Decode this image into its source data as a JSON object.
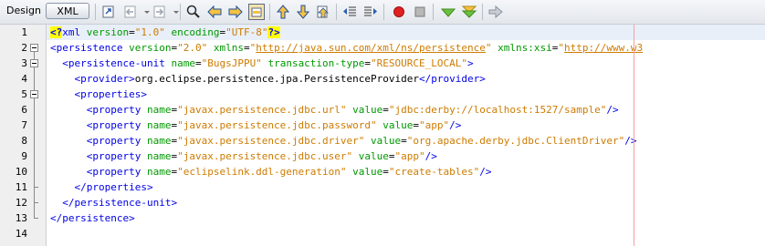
{
  "toolbar": {
    "design_tab": "Design",
    "xml_tab": "XML",
    "icons": [
      "go-to-source-icon",
      "back-icon",
      "forward-icon",
      "find-icon",
      "find-previous-icon",
      "find-next-icon",
      "toggle-highlight-icon",
      "previous-bookmark-icon",
      "next-bookmark-icon",
      "toggle-bookmark-icon",
      "shift-left-icon",
      "shift-right-icon",
      "start-macro-icon",
      "stop-macro-icon",
      "check-xml-icon",
      "validate-xml-icon",
      "xsl-transform-icon"
    ]
  },
  "editor": {
    "line_numbers": [
      "1",
      "2",
      "3",
      "4",
      "5",
      "6",
      "7",
      "8",
      "9",
      "10",
      "11",
      "12",
      "13",
      "14"
    ],
    "lines": [
      [
        {
          "t": "<?",
          "c": "pi"
        },
        {
          "t": "xml",
          "c": "tag"
        },
        {
          "t": " version",
          "c": "att"
        },
        {
          "t": "=",
          "c": "txt"
        },
        {
          "t": "\"1.0\"",
          "c": "val"
        },
        {
          "t": " encoding",
          "c": "att"
        },
        {
          "t": "=",
          "c": "txt"
        },
        {
          "t": "\"UTF-8\"",
          "c": "val"
        },
        {
          "t": "?>",
          "c": "pi"
        }
      ],
      [
        {
          "t": "<persistence",
          "c": "tag"
        },
        {
          "t": " version",
          "c": "att"
        },
        {
          "t": "=",
          "c": "txt"
        },
        {
          "t": "\"2.0\"",
          "c": "val"
        },
        {
          "t": " xmlns",
          "c": "att"
        },
        {
          "t": "=",
          "c": "txt"
        },
        {
          "t": "\"",
          "c": "val"
        },
        {
          "t": "http://java.sun.com/xml/ns/persistence",
          "c": "link"
        },
        {
          "t": "\"",
          "c": "val"
        },
        {
          "t": " xmlns:xsi",
          "c": "att"
        },
        {
          "t": "=",
          "c": "txt"
        },
        {
          "t": "\"",
          "c": "val"
        },
        {
          "t": "http://www.w3",
          "c": "link"
        }
      ],
      [
        {
          "t": "  <persistence-unit",
          "c": "tag"
        },
        {
          "t": " name",
          "c": "att"
        },
        {
          "t": "=",
          "c": "txt"
        },
        {
          "t": "\"BugsJPPU\"",
          "c": "val"
        },
        {
          "t": " transaction-type",
          "c": "att"
        },
        {
          "t": "=",
          "c": "txt"
        },
        {
          "t": "\"RESOURCE_LOCAL\"",
          "c": "val"
        },
        {
          "t": ">",
          "c": "tag"
        }
      ],
      [
        {
          "t": "    <provider>",
          "c": "tag"
        },
        {
          "t": "org.eclipse.persistence.jpa.PersistenceProvider",
          "c": "txt"
        },
        {
          "t": "</provider>",
          "c": "tag"
        }
      ],
      [
        {
          "t": "    <properties>",
          "c": "tag"
        }
      ],
      [
        {
          "t": "      <property",
          "c": "tag"
        },
        {
          "t": " name",
          "c": "att"
        },
        {
          "t": "=",
          "c": "txt"
        },
        {
          "t": "\"javax.persistence.jdbc.url\"",
          "c": "val"
        },
        {
          "t": " value",
          "c": "att"
        },
        {
          "t": "=",
          "c": "txt"
        },
        {
          "t": "\"jdbc:derby://localhost:1527/sample\"",
          "c": "val"
        },
        {
          "t": "/>",
          "c": "tag"
        }
      ],
      [
        {
          "t": "      <property",
          "c": "tag"
        },
        {
          "t": " name",
          "c": "att"
        },
        {
          "t": "=",
          "c": "txt"
        },
        {
          "t": "\"javax.persistence.jdbc.password\"",
          "c": "val"
        },
        {
          "t": " value",
          "c": "att"
        },
        {
          "t": "=",
          "c": "txt"
        },
        {
          "t": "\"app\"",
          "c": "val"
        },
        {
          "t": "/>",
          "c": "tag"
        }
      ],
      [
        {
          "t": "      <property",
          "c": "tag"
        },
        {
          "t": " name",
          "c": "att"
        },
        {
          "t": "=",
          "c": "txt"
        },
        {
          "t": "\"javax.persistence.jdbc.driver\"",
          "c": "val"
        },
        {
          "t": " value",
          "c": "att"
        },
        {
          "t": "=",
          "c": "txt"
        },
        {
          "t": "\"org.apache.derby.jdbc.ClientDriver\"",
          "c": "val"
        },
        {
          "t": "/>",
          "c": "tag"
        }
      ],
      [
        {
          "t": "      <property",
          "c": "tag"
        },
        {
          "t": " name",
          "c": "att"
        },
        {
          "t": "=",
          "c": "txt"
        },
        {
          "t": "\"javax.persistence.jdbc.user\"",
          "c": "val"
        },
        {
          "t": " value",
          "c": "att"
        },
        {
          "t": "=",
          "c": "txt"
        },
        {
          "t": "\"app\"",
          "c": "val"
        },
        {
          "t": "/>",
          "c": "tag"
        }
      ],
      [
        {
          "t": "      <property",
          "c": "tag"
        },
        {
          "t": " name",
          "c": "att"
        },
        {
          "t": "=",
          "c": "txt"
        },
        {
          "t": "\"eclipselink.ddl-generation\"",
          "c": "val"
        },
        {
          "t": " value",
          "c": "att"
        },
        {
          "t": "=",
          "c": "txt"
        },
        {
          "t": "\"create-tables\"",
          "c": "val"
        },
        {
          "t": "/>",
          "c": "tag"
        }
      ],
      [
        {
          "t": "    </properties>",
          "c": "tag"
        }
      ],
      [
        {
          "t": "  </persistence-unit>",
          "c": "tag"
        }
      ],
      [
        {
          "t": "</persistence>",
          "c": "tag"
        }
      ],
      []
    ]
  }
}
